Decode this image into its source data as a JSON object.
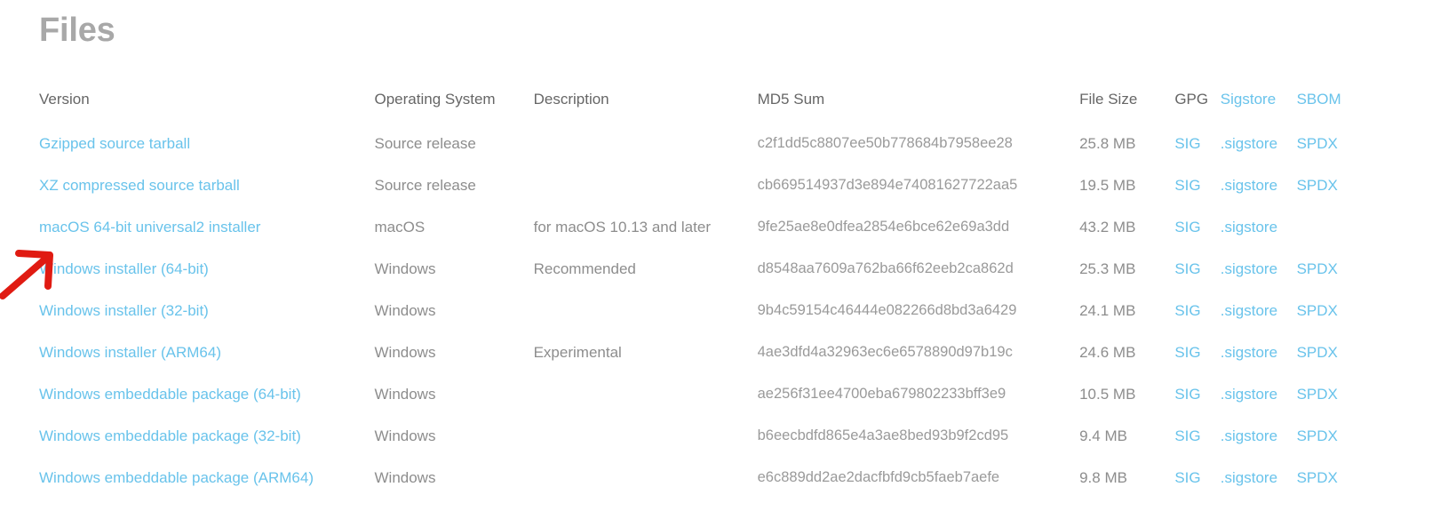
{
  "page_title": "Files",
  "table": {
    "headers": {
      "version": "Version",
      "operating_system": "Operating System",
      "description": "Description",
      "md5_sum": "MD5 Sum",
      "file_size": "File Size",
      "gpg": "GPG",
      "sigstore": "Sigstore",
      "sbom": "SBOM"
    },
    "rows": [
      {
        "version": "Gzipped source tarball",
        "operating_system": "Source release",
        "description": "",
        "md5": "c2f1dd5c8807ee50b778684b7958ee28",
        "file_size": "25.8 MB",
        "gpg": "SIG",
        "sigstore": ".sigstore",
        "sbom": "SPDX"
      },
      {
        "version": "XZ compressed source tarball",
        "operating_system": "Source release",
        "description": "",
        "md5": "cb669514937d3e894e74081627722aa5",
        "file_size": "19.5 MB",
        "gpg": "SIG",
        "sigstore": ".sigstore",
        "sbom": "SPDX"
      },
      {
        "version": "macOS 64-bit universal2 installer",
        "operating_system": "macOS",
        "description": "for macOS 10.13 and later",
        "md5": "9fe25ae8e0dfea2854e6bce62e69a3dd",
        "file_size": "43.2 MB",
        "gpg": "SIG",
        "sigstore": ".sigstore",
        "sbom": ""
      },
      {
        "version": "Windows installer (64-bit)",
        "operating_system": "Windows",
        "description": "Recommended",
        "md5": "d8548aa7609a762ba66f62eeb2ca862d",
        "file_size": "25.3 MB",
        "gpg": "SIG",
        "sigstore": ".sigstore",
        "sbom": "SPDX"
      },
      {
        "version": "Windows installer (32-bit)",
        "operating_system": "Windows",
        "description": "",
        "md5": "9b4c59154c46444e082266d8bd3a6429",
        "file_size": "24.1 MB",
        "gpg": "SIG",
        "sigstore": ".sigstore",
        "sbom": "SPDX"
      },
      {
        "version": "Windows installer (ARM64)",
        "operating_system": "Windows",
        "description": "Experimental",
        "md5": "4ae3dfd4a32963ec6e6578890d97b19c",
        "file_size": "24.6 MB",
        "gpg": "SIG",
        "sigstore": ".sigstore",
        "sbom": "SPDX"
      },
      {
        "version": "Windows embeddable package (64-bit)",
        "operating_system": "Windows",
        "description": "",
        "md5": "ae256f31ee4700eba679802233bff3e9",
        "file_size": "10.5 MB",
        "gpg": "SIG",
        "sigstore": ".sigstore",
        "sbom": "SPDX"
      },
      {
        "version": "Windows embeddable package (32-bit)",
        "operating_system": "Windows",
        "description": "",
        "md5": "b6eecbdfd865e4a3ae8bed93b9f2cd95",
        "file_size": "9.4 MB",
        "gpg": "SIG",
        "sigstore": ".sigstore",
        "sbom": "SPDX"
      },
      {
        "version": "Windows embeddable package (ARM64)",
        "operating_system": "Windows",
        "description": "",
        "md5": "e6c889dd2ae2dacfbfd9cb5faeb7aefe",
        "file_size": "9.8 MB",
        "gpg": "SIG",
        "sigstore": ".sigstore",
        "sbom": "SPDX"
      }
    ]
  },
  "annotation": {
    "arrow_color": "#e01b12",
    "points_to": "Windows installer (64-bit)"
  },
  "colors": {
    "link": "#69c3eb",
    "heading": "#a8a8a8",
    "body_text": "#8d8d8d",
    "header_text": "#666666",
    "background": "#ffffff"
  }
}
